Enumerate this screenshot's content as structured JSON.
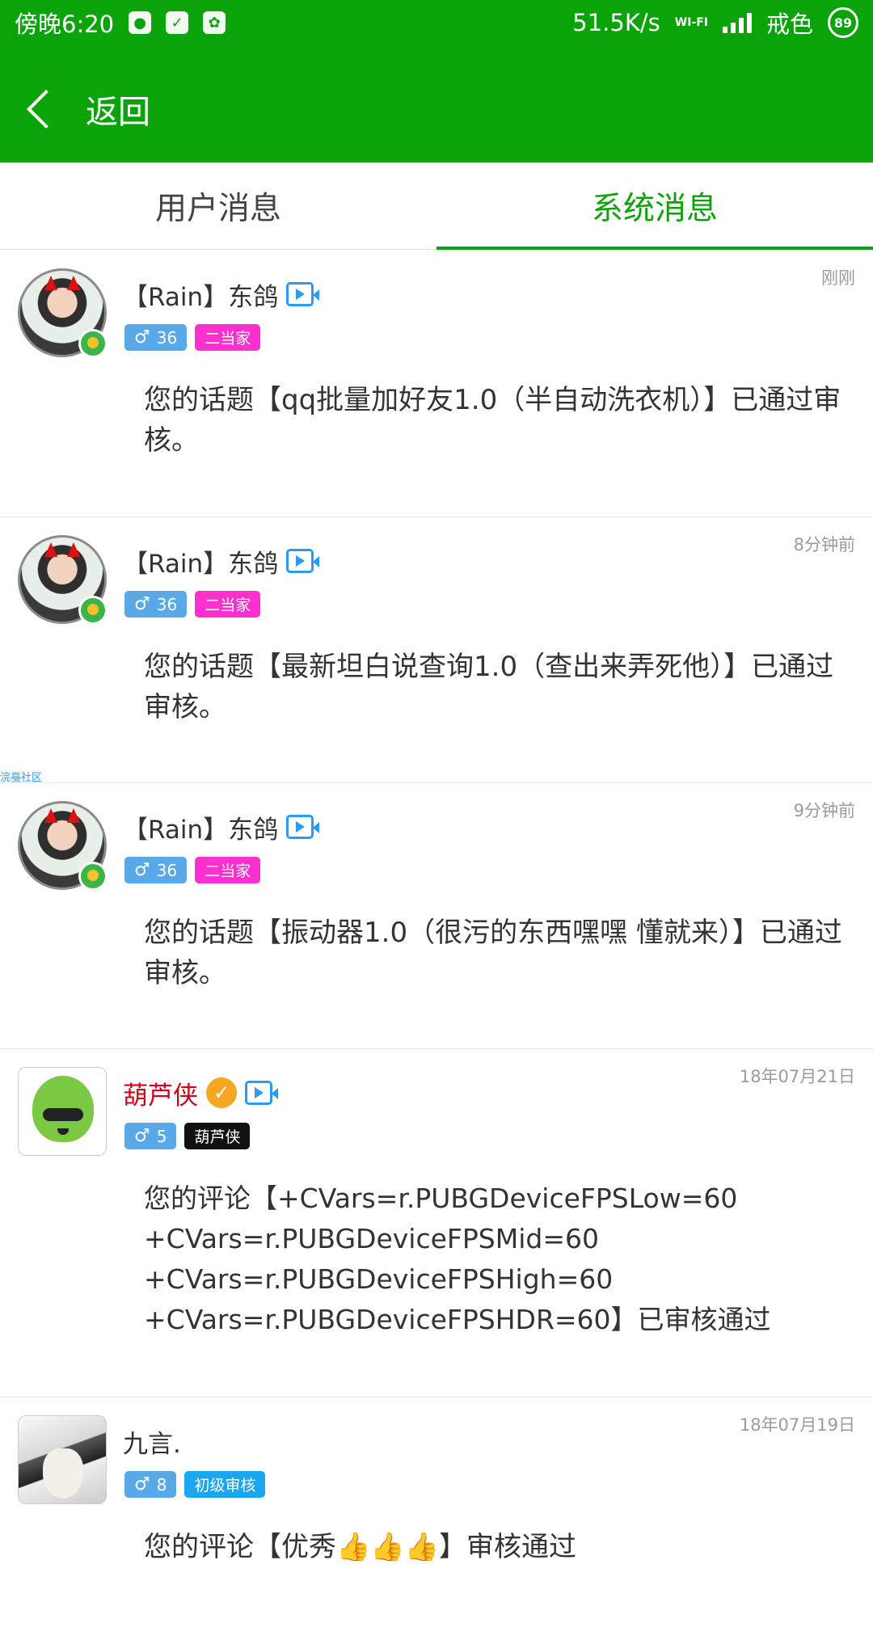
{
  "status_bar": {
    "time": "傍晚6:20",
    "net_speed": "51.5K/s",
    "carrier": "戒色",
    "battery": "89",
    "wifi_label": "WI-FI"
  },
  "nav": {
    "back_label": "返回"
  },
  "tabs": [
    {
      "label": "用户消息",
      "active": false
    },
    {
      "label": "系统消息",
      "active": true
    }
  ],
  "watermark": "浣戞社区",
  "messages": [
    {
      "username": "【Rain】东鸽",
      "gender_level": "36",
      "rank": "二当家",
      "rank_color": "#ff2fd0",
      "time": "刚刚",
      "body": "您的话题【qq批量加好友1.0（半自动洗衣机）】已通过审核。"
    },
    {
      "username": "【Rain】东鸽",
      "gender_level": "36",
      "rank": "二当家",
      "rank_color": "#ff2fd0",
      "time": "8分钟前",
      "body": "您的话题【最新坦白说查询1.0（查出来弄死他）】已通过审核。"
    },
    {
      "username": "【Rain】东鸽",
      "gender_level": "36",
      "rank": "二当家",
      "rank_color": "#ff2fd0",
      "time": "9分钟前",
      "body": "您的话题【振动器1.0（很污的东西嘿嘿 懂就来）】已通过审核。"
    },
    {
      "username": "葫芦侠",
      "gender_level": "5",
      "rank": "葫芦侠",
      "rank_color": "#111111",
      "time": "18年07月21日",
      "body_lines": [
        "您的评论【+CVars=r.PUBGDeviceFPSLow=60",
        "+CVars=r.PUBGDeviceFPSMid=60",
        "+CVars=r.PUBGDeviceFPSHigh=60",
        "+CVars=r.PUBGDeviceFPSHDR=60】已审核通过"
      ]
    },
    {
      "username": "九言.",
      "gender_level": "8",
      "rank": "初级审核",
      "rank_color": "#1aa6f0",
      "time": "18年07月19日",
      "body": "您的评论【优秀👍👍👍】审核通过"
    }
  ],
  "icons": {
    "gender": "male-symbol",
    "back": "chevron-left-icon",
    "video": "video-camera-icon",
    "verified": "verified-badge-icon"
  },
  "colors": {
    "primary_green": "#0aa30a",
    "gender_blue": "#59a9e8"
  }
}
